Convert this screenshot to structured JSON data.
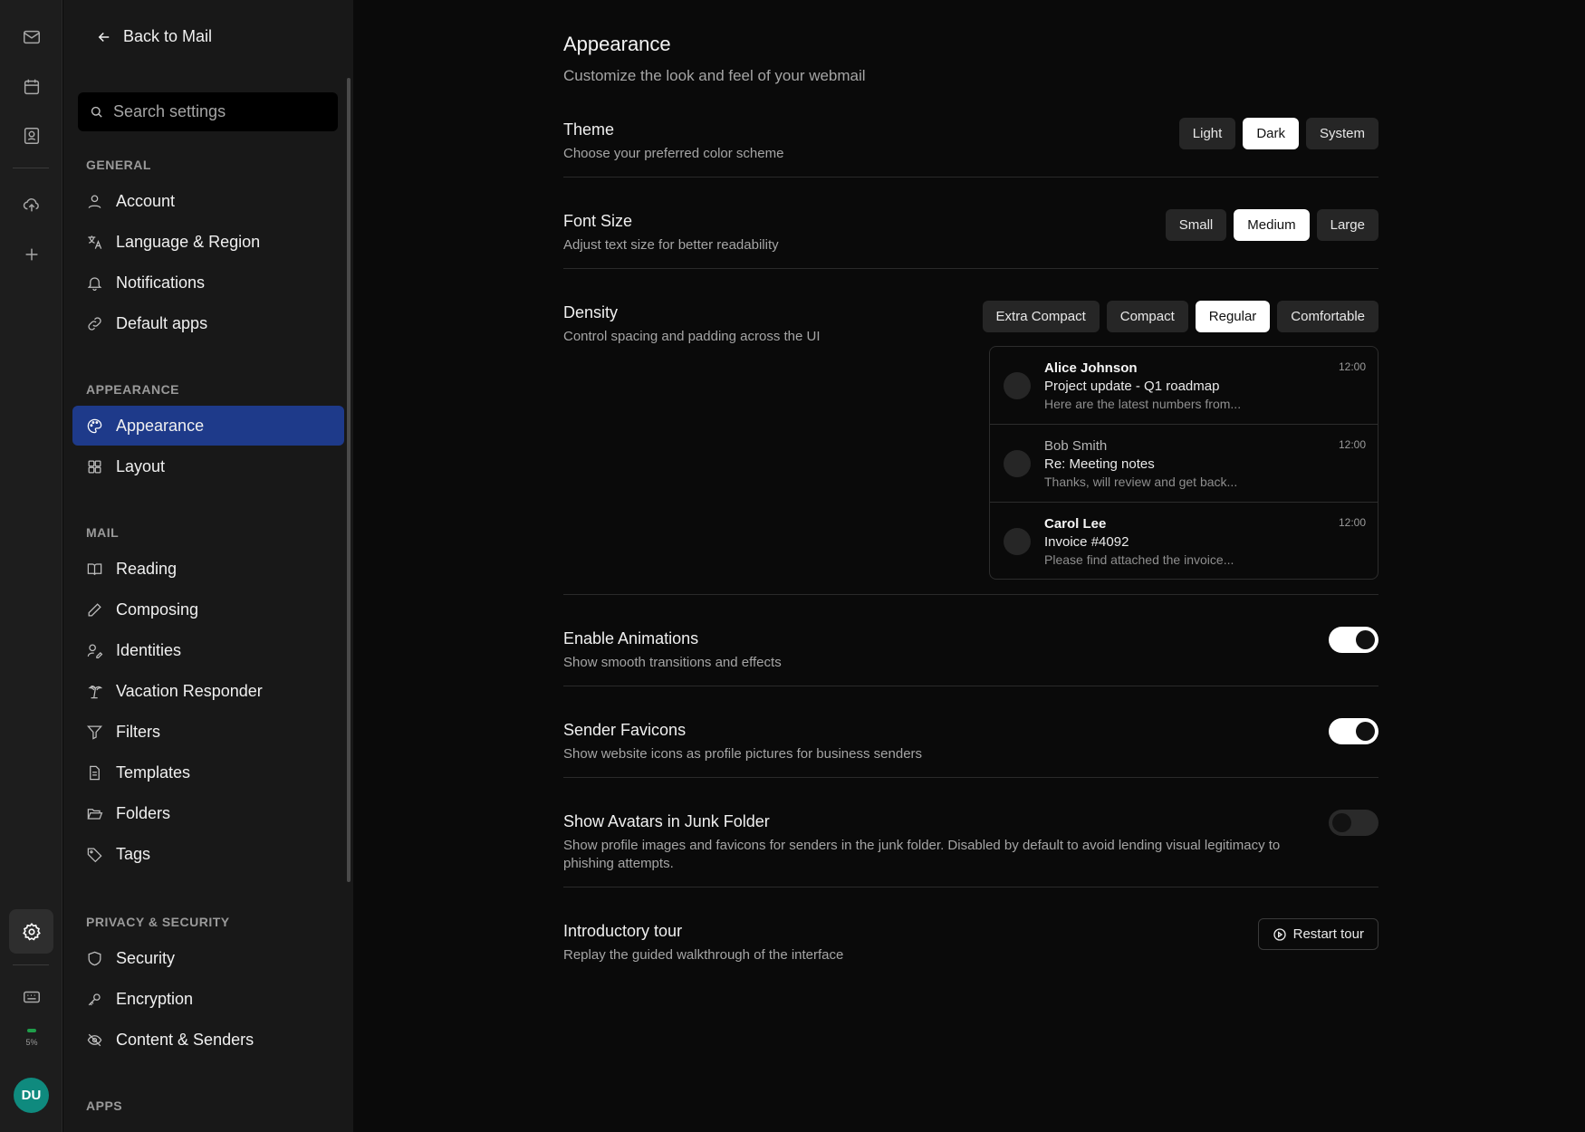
{
  "rail": {
    "icons": [
      "mail-icon",
      "calendar-icon",
      "contacts-icon",
      "cloud-upload-icon",
      "plus-icon",
      "settings-icon",
      "keyboard-icon"
    ],
    "storage_label": "5%",
    "avatar_initials": "DU"
  },
  "sidebar": {
    "back_label": "Back to Mail",
    "search_placeholder": "Search settings",
    "sections": {
      "general": "GENERAL",
      "appearance": "APPEARANCE",
      "mail": "MAIL",
      "privacy": "PRIVACY & SECURITY",
      "apps": "APPS"
    },
    "items": {
      "account": "Account",
      "language": "Language & Region",
      "notifications": "Notifications",
      "default_apps": "Default apps",
      "appearance": "Appearance",
      "layout": "Layout",
      "reading": "Reading",
      "composing": "Composing",
      "identities": "Identities",
      "vacation": "Vacation Responder",
      "filters": "Filters",
      "templates": "Templates",
      "folders": "Folders",
      "tags": "Tags",
      "security": "Security",
      "encryption": "Encryption",
      "content_senders": "Content & Senders"
    },
    "active_item": "Appearance"
  },
  "main": {
    "title": "Appearance",
    "subtitle": "Customize the look and feel of your webmail",
    "theme": {
      "title": "Theme",
      "desc": "Choose your preferred color scheme",
      "options": [
        "Light",
        "Dark",
        "System"
      ],
      "selected": "Dark"
    },
    "font_size": {
      "title": "Font Size",
      "desc": "Adjust text size for better readability",
      "options": [
        "Small",
        "Medium",
        "Large"
      ],
      "selected": "Medium"
    },
    "density": {
      "title": "Density",
      "desc": "Control spacing and padding across the UI",
      "options": [
        "Extra Compact",
        "Compact",
        "Regular",
        "Comfortable"
      ],
      "selected": "Regular",
      "preview": [
        {
          "from": "Alice Johnson",
          "subject": "Project update - Q1 roadmap",
          "snippet": "Here are the latest numbers from...",
          "time": "12:00",
          "unread": true
        },
        {
          "from": "Bob Smith",
          "subject": "Re: Meeting notes",
          "snippet": "Thanks, will review and get back...",
          "time": "12:00",
          "unread": false
        },
        {
          "from": "Carol Lee",
          "subject": "Invoice #4092",
          "snippet": "Please find attached the invoice...",
          "time": "12:00",
          "unread": true
        }
      ]
    },
    "animations": {
      "title": "Enable Animations",
      "desc": "Show smooth transitions and effects",
      "enabled": true
    },
    "favicons": {
      "title": "Sender Favicons",
      "desc": "Show website icons as profile pictures for business senders",
      "enabled": true
    },
    "junk_avatars": {
      "title": "Show Avatars in Junk Folder",
      "desc": "Show profile images and favicons for senders in the junk folder. Disabled by default to avoid lending visual legitimacy to phishing attempts.",
      "enabled": false
    },
    "tour": {
      "title": "Introductory tour",
      "desc": "Replay the guided walkthrough of the interface",
      "button": "Restart tour"
    }
  },
  "colors": {
    "accent_active": "#1e3a8a",
    "avatar_bg": "#0f8a7e",
    "storage_bar": "#1f9e4a"
  }
}
